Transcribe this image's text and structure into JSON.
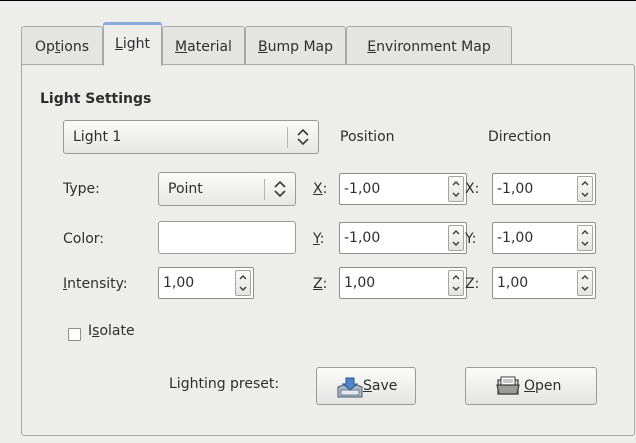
{
  "tabs": [
    {
      "label": "Options",
      "pre": "Op",
      "key": "t",
      "post": "ions"
    },
    {
      "label": "Light",
      "pre": "",
      "key": "L",
      "post": "ight"
    },
    {
      "label": "Material",
      "pre": "",
      "key": "M",
      "post": "aterial"
    },
    {
      "label": "Bump Map",
      "pre": "",
      "key": "B",
      "post": "ump Map"
    },
    {
      "label": "Environment Map",
      "pre": "",
      "key": "E",
      "post": "nvironment Map"
    }
  ],
  "active_tab": "Light",
  "section_title": "Light Settings",
  "light_select": {
    "value": "Light 1"
  },
  "column_headers": {
    "position": "Position",
    "direction": "Direction"
  },
  "type": {
    "label": "Type:",
    "value": "Point"
  },
  "color": {
    "label": "Color:",
    "swatch": "#ffffff"
  },
  "intensity": {
    "label_key": "I",
    "label_rest": "ntensity:",
    "value": "1,00"
  },
  "position": {
    "x": {
      "key": "X",
      "rest": ":",
      "value": "-1,00"
    },
    "y": {
      "key": "Y",
      "rest": ":",
      "value": "-1,00"
    },
    "z": {
      "key": "Z",
      "rest": ":",
      "value": "1,00"
    }
  },
  "direction": {
    "x": {
      "label": "X:",
      "value": "-1,00"
    },
    "y": {
      "label": "Y:",
      "value": "-1,00"
    },
    "z": {
      "label": "Z:",
      "value": "1,00"
    }
  },
  "isolate": {
    "pre": "I",
    "key": "s",
    "post": "olate",
    "checked": false
  },
  "preset": {
    "label": "Lighting preset:",
    "save": {
      "key": "S",
      "rest": "ave",
      "icon": "save-icon"
    },
    "open": {
      "key": "O",
      "rest": "pen",
      "icon": "open-folder-icon"
    }
  },
  "colors": {
    "accent": "#86abd9",
    "background": "#ededec",
    "border": "#a8a8a6"
  }
}
